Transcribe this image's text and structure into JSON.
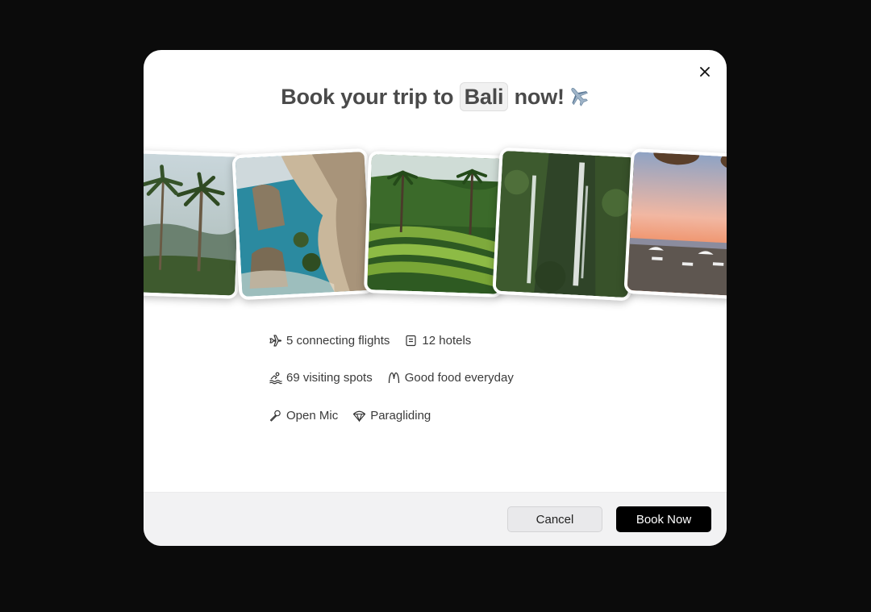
{
  "dialog": {
    "title_prefix": "Book your trip to",
    "destination": "Bali",
    "title_suffix": "now!",
    "title_emoji": "airplane-icon"
  },
  "gallery": [
    {
      "name": "palm-trees-photo"
    },
    {
      "name": "coastal-cliffs-photo"
    },
    {
      "name": "rice-terraces-photo"
    },
    {
      "name": "waterfall-photo"
    },
    {
      "name": "beach-sunset-photo"
    }
  ],
  "features": [
    {
      "icon": "plane-icon",
      "label": "5 connecting flights"
    },
    {
      "icon": "hotel-icon",
      "label": "12 hotels"
    },
    {
      "icon": "swimmer-icon",
      "label": "69 visiting spots"
    },
    {
      "icon": "food-icon",
      "label": "Good food everyday"
    },
    {
      "icon": "microphone-icon",
      "label": "Open Mic"
    },
    {
      "icon": "parachute-icon",
      "label": "Paragliding"
    }
  ],
  "footer": {
    "cancel_label": "Cancel",
    "book_label": "Book Now"
  }
}
